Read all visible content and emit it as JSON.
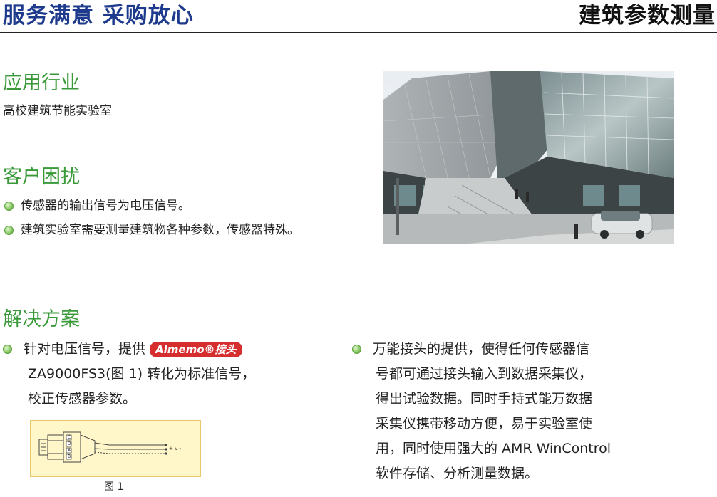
{
  "header": {
    "left_title": "服务满意 采购放心",
    "right_title": "建筑参数测量"
  },
  "application": {
    "title": "应用行业",
    "text": "高校建筑节能实验室"
  },
  "problems": {
    "title": "客户困扰",
    "items": [
      "传感器的输出信号为电压信号。",
      "建筑实验室需要测量建筑物各种参数，传感器特殊。"
    ]
  },
  "solution": {
    "title": "解决方案",
    "left": {
      "line1_prefix": "针对电压信号，提供",
      "badge": "Almemo®接头",
      "line2": "ZA9000FS3(图 1) 转化为标准信号，",
      "line3": "校正传感器参数。"
    },
    "right": {
      "lines": [
        "万能接头的提供，使得任何传感器信",
        "号都可通过接头输入到数据采集仪，",
        "得出试验数据。同时手持式能万数据",
        "采集仪携带移动方便，易于实验室使",
        "用，同时使用强大的 AMR WinControl",
        "软件存储、分析测量数据。"
      ]
    },
    "figure": {
      "caption": "图 1",
      "pin_labels": [
        "C",
        "D",
        "A",
        "B"
      ],
      "wire_label": "+ v -"
    }
  },
  "colors": {
    "header_blue": "#1e3a8c",
    "section_green": "#3a9a3a",
    "badge_red": "#d62e2e",
    "figure_bg": "#fff6c9"
  },
  "icons": {
    "bullet": "green-circle-bullet-icon"
  }
}
